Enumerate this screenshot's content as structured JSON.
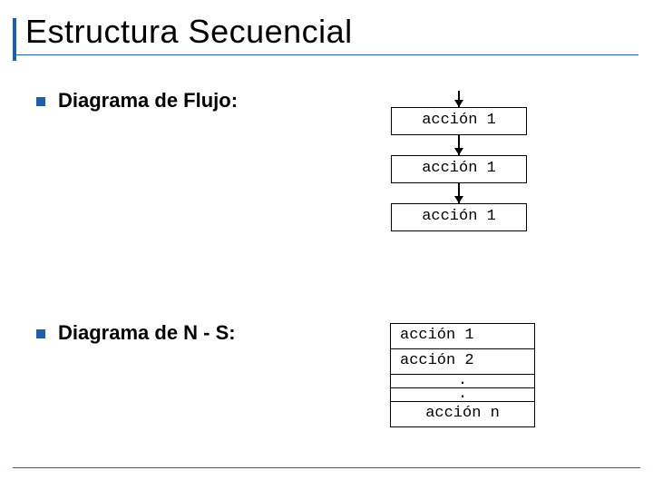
{
  "title": "Estructura Secuencial",
  "bullets": {
    "flujo": "Diagrama de Flujo:",
    "ns": "Diagrama de N - S:"
  },
  "flow": {
    "box1": "acción 1",
    "box2": "acción 1",
    "box3": "acción 1"
  },
  "ns": {
    "r1": "acción 1",
    "r2": "acción 2",
    "dot1": ".",
    "dot2": ".",
    "rn": "acción n"
  }
}
